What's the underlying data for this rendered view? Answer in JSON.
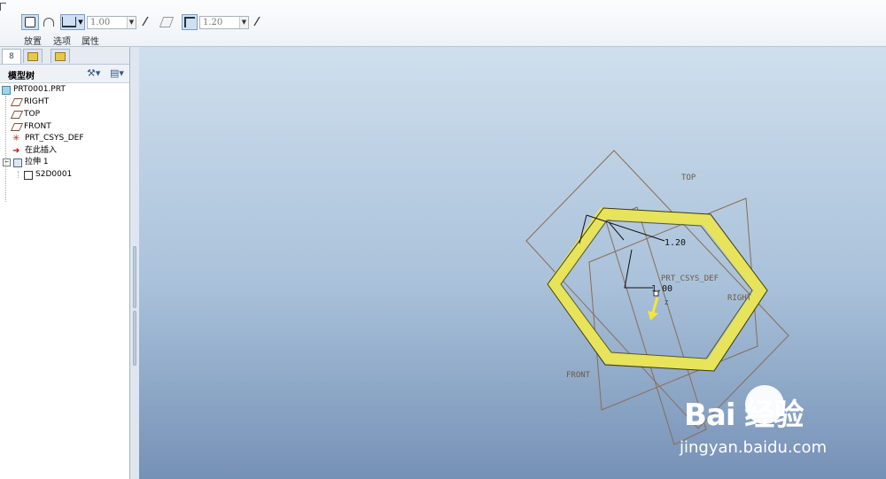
{
  "ribbon": {
    "labels": {
      "placement": "放置",
      "options": "选项",
      "properties": "属性"
    },
    "depth_value": "1.00",
    "thickness_value": "1.20"
  },
  "model_tree": {
    "title": "模型树",
    "items": [
      {
        "label": "PRT0001.PRT",
        "icon": "part-icon"
      },
      {
        "label": "RIGHT",
        "icon": "datum-plane-icon"
      },
      {
        "label": "TOP",
        "icon": "datum-plane-icon"
      },
      {
        "label": "FRONT",
        "icon": "datum-plane-icon"
      },
      {
        "label": "PRT_CSYS_DEF",
        "icon": "csys-icon"
      },
      {
        "label": "在此插入",
        "icon": "insert-arrow-icon"
      },
      {
        "label": "拉伸 1",
        "icon": "extrude-icon"
      },
      {
        "label": "S2D0001",
        "icon": "sketch-icon"
      }
    ]
  },
  "viewport": {
    "dim_thickness": "1.20",
    "dim_depth": "1.00",
    "datum_top": "TOP",
    "datum_right": "RIGHT",
    "datum_front": "FRONT",
    "csys": "PRT_CSYS_DEF",
    "axis_z": "Z"
  },
  "watermark": {
    "brand": "Bai  经验",
    "url": "jingyan.baidu.com"
  },
  "colors": {
    "accent": "#cfe0f3",
    "model_yellow": "#e7e35a",
    "datum_brown": "#8a6d55",
    "viewport_top": "#cfdfed",
    "viewport_bottom": "#7591b6"
  }
}
